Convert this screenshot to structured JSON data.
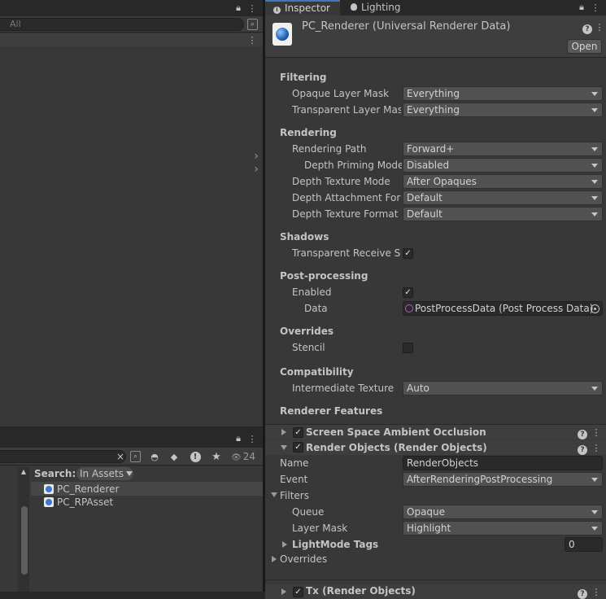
{
  "left_top": {
    "search_placeholder": "All"
  },
  "project": {
    "search_label": "Search:",
    "scope_label": "In Assets",
    "hidden_count": "24",
    "assets": [
      "PC_Renderer",
      "PC_RPAsset"
    ]
  },
  "inspector": {
    "tabs": [
      {
        "label": "Inspector",
        "icon": "info-icon"
      },
      {
        "label": "Lighting",
        "icon": "bulb-icon"
      }
    ],
    "title": "PC_Renderer (Universal Renderer Data)",
    "open_label": "Open",
    "sections": {
      "filtering": "Filtering",
      "rendering": "Rendering",
      "shadows": "Shadows",
      "post": "Post-processing",
      "overrides": "Overrides",
      "compat": "Compatibility",
      "features": "Renderer Features"
    },
    "fields": {
      "opaque_mask": {
        "label": "Opaque Layer Mask",
        "value": "Everything"
      },
      "transparent_mask": {
        "label": "Transparent Layer Mask",
        "value": "Everything"
      },
      "rendering_path": {
        "label": "Rendering Path",
        "value": "Forward+"
      },
      "depth_priming": {
        "label": "Depth Priming Mode",
        "value": "Disabled"
      },
      "depth_texture_mode": {
        "label": "Depth Texture Mode",
        "value": "After Opaques"
      },
      "depth_attachment": {
        "label": "Depth Attachment Format",
        "value": "Default"
      },
      "depth_texture_format": {
        "label": "Depth Texture Format",
        "value": "Default"
      },
      "transparent_receive": {
        "label": "Transparent Receive Shadows",
        "checked": true
      },
      "pp_enabled": {
        "label": "Enabled",
        "checked": true
      },
      "pp_data": {
        "label": "Data",
        "value": "PostProcessData (Post Process Data)"
      },
      "stencil": {
        "label": "Stencil",
        "checked": false
      },
      "intermediate": {
        "label": "Intermediate Texture",
        "value": "Auto"
      }
    },
    "features": {
      "ssao": "Screen Space Ambient Occlusion",
      "render_objects": "Render Objects (Render Objects)",
      "name_label": "Name",
      "name_value": "RenderObjects",
      "event_label": "Event",
      "event_value": "AfterRenderingPostProcessing",
      "filters_label": "Filters",
      "queue_label": "Queue",
      "queue_value": "Opaque",
      "layer_mask_label": "Layer Mask",
      "layer_mask_value": "Highlight",
      "lightmode_label": "LightMode Tags",
      "lightmode_value": "0",
      "overrides_label": "Overrides",
      "next_feature": "Tx (Render Objects)"
    }
  },
  "colors": {
    "panel": "#383838",
    "tab_bar": "#282828",
    "field": "#515151"
  }
}
